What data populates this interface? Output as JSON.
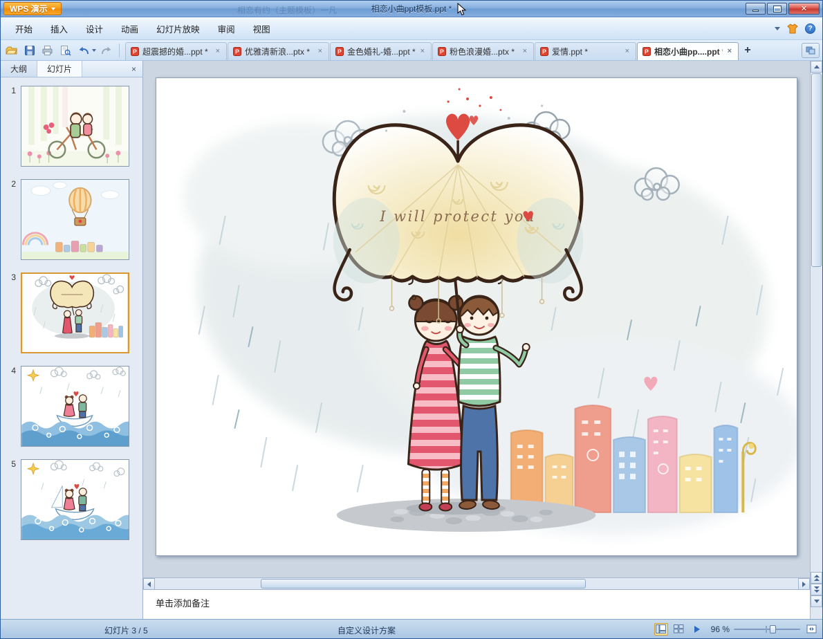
{
  "titlebar": {
    "app_button": "WPS 演示",
    "ghost_text": "相恋有约（主题模板）一凡",
    "title": "相恋小曲ppt模板.ppt *"
  },
  "menu": {
    "items": [
      "开始",
      "插入",
      "设计",
      "动画",
      "幻灯片放映",
      "审阅",
      "视图"
    ]
  },
  "doc_tabs": [
    "超震撼的婚...ppt *",
    "优雅清新浪...ptx *",
    "金色婚礼-婚...ppt *",
    "粉色浪漫婚...ptx *",
    "爱情.ppt *",
    "相恋小曲pp....ppt *"
  ],
  "glyphs": {
    "window_close": "✕",
    "tab_close": "×",
    "new_tab": "+",
    "help": "?",
    "pane_close": "×"
  },
  "sidebar": {
    "outline_tab": "大纲",
    "slides_tab": "幻灯片",
    "numbers": [
      "1",
      "2",
      "3",
      "4",
      "5"
    ],
    "selected_slide": 3
  },
  "slide": {
    "caption": "I will protect you"
  },
  "notes": {
    "placeholder": "单击添加备注"
  },
  "statusbar": {
    "slide_info": "幻灯片 3 / 5",
    "design_scheme": "自定义设计方案",
    "zoom": "96 %"
  },
  "colors": {
    "accent_orange": "#f59a16",
    "titlebar_blue": "#6e9cd4",
    "close_red": "#c53a30",
    "selected_thumb_border": "#d89a30"
  }
}
